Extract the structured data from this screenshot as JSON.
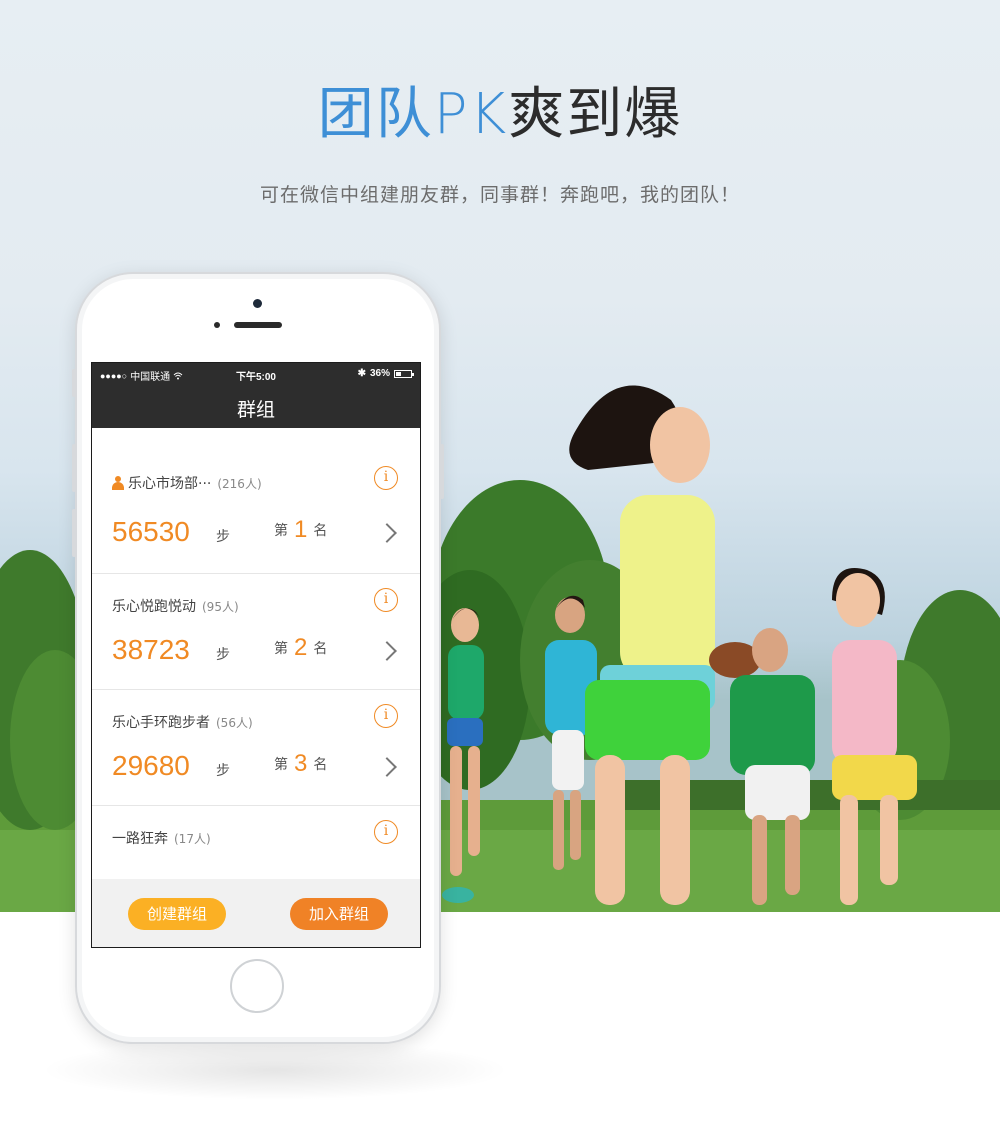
{
  "headline": {
    "blue_part": "团队PK",
    "dark_part": "爽到爆"
  },
  "subline": "可在微信中组建朋友群，同事群！奔跑吧，我的团队！",
  "phone": {
    "status": {
      "carrier": "中国联通",
      "time": "下午5:00",
      "battery": "36%",
      "battery_level": 0.36
    },
    "nav_title": "群组",
    "groups": [
      {
        "name": "乐心市场部···",
        "count": "(216人)",
        "steps": "56530",
        "steps_unit": "步",
        "rank_prefix": "第",
        "rank": "1",
        "rank_suffix": "名"
      },
      {
        "name": "乐心悦跑悦动",
        "count": "(95人)",
        "steps": "38723",
        "steps_unit": "步",
        "rank_prefix": "第",
        "rank": "2",
        "rank_suffix": "名"
      },
      {
        "name": "乐心手环跑步者",
        "count": "(56人)",
        "steps": "29680",
        "steps_unit": "步",
        "rank_prefix": "第",
        "rank": "3",
        "rank_suffix": "名"
      },
      {
        "name": "一路狂奔",
        "count": "(17人)"
      }
    ],
    "buttons": {
      "create": "创建群组",
      "join": "加入群组"
    }
  },
  "colors": {
    "accent_orange": "#f08a24",
    "create_button": "#fbb024",
    "join_button": "#f08226",
    "headline_blue": "#3e8fd6",
    "navbar": "#2d2d2d"
  }
}
